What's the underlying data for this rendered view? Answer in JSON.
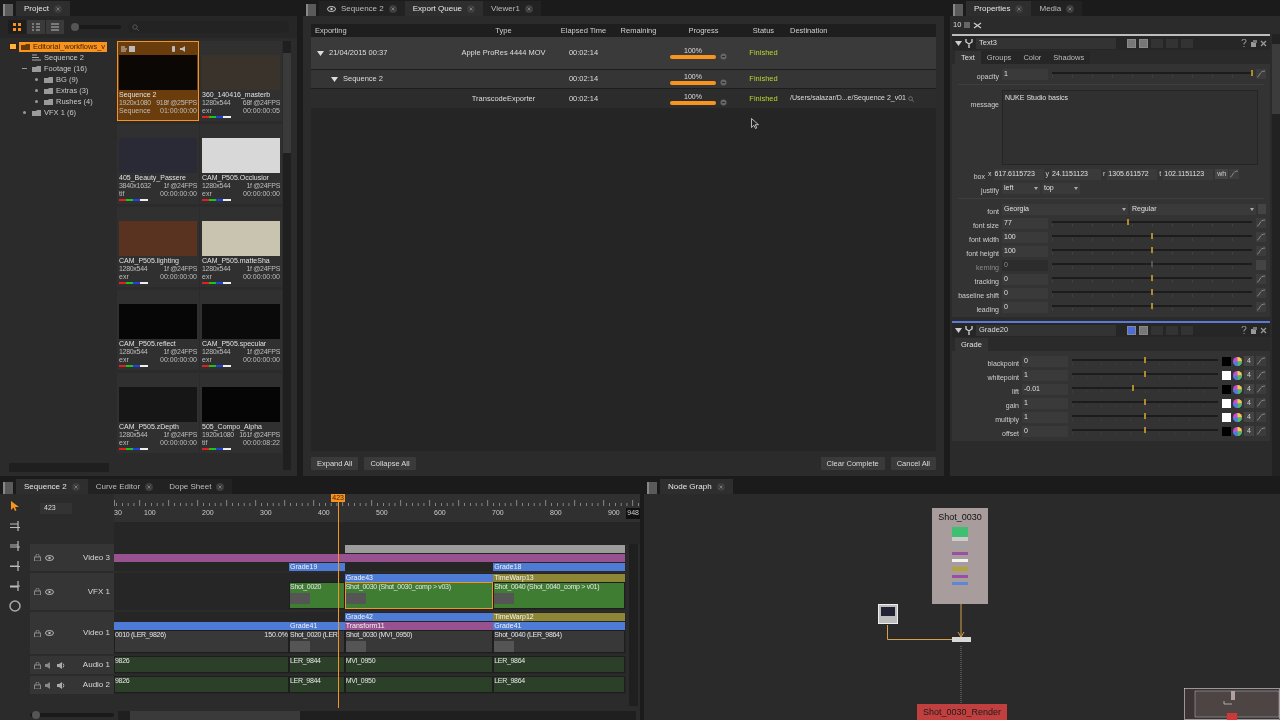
{
  "project": {
    "zoom": {
      "level": 0.08
    },
    "tabs": [
      {
        "label": "Project",
        "selected": true
      }
    ],
    "tree": [
      {
        "label": "Editorial_workflows_v",
        "kind": "project",
        "selected": true,
        "expanded": true,
        "children": [
          {
            "label": "Sequence 2",
            "kind": "sequence",
            "selected": false
          },
          {
            "label": "Footage (16)",
            "kind": "bin",
            "selected": false,
            "expanded": true,
            "children": [
              {
                "label": "BG (9)",
                "kind": "bin",
                "selected": false,
                "expanded": false
              },
              {
                "label": "Extras (3)",
                "kind": "bin",
                "selected": false,
                "expanded": false
              },
              {
                "label": "Rushes (4)",
                "kind": "bin",
                "selected": false,
                "expanded": false
              }
            ]
          },
          {
            "label": "VFX 1 (6)",
            "kind": "bin",
            "selected": false,
            "expanded": false
          }
        ]
      }
    ],
    "clips": [
      {
        "kind": "sequence",
        "name": "Sequence 2",
        "resolution": "1920x1080",
        "duration": "918f @25FPS",
        "type": "Sequence",
        "timecode": "01:00:00:00",
        "selected": true
      },
      {
        "kind": "clip",
        "name": "360_140416_masterb",
        "resolution": "1280x544",
        "duration": "68f @24FPS",
        "type": "exr",
        "timecode": "00:00:00:05",
        "selected": false
      },
      {
        "kind": "clip",
        "name": "405_Beauty_Passere",
        "resolution": "3840x1632",
        "duration": "1f @24FPS",
        "type": "tif",
        "timecode": "00:00:00:00",
        "selected": false
      },
      {
        "kind": "clip",
        "name": "CAM_P505.Occlusior",
        "resolution": "1280x544",
        "duration": "1f @24FPS",
        "type": "exr",
        "timecode": "00:00:00:00",
        "selected": false
      },
      {
        "kind": "clip",
        "name": "CAM_P505.lighting",
        "resolution": "1280x544",
        "duration": "1f @24FPS",
        "type": "exr",
        "timecode": "00:00:00:00",
        "selected": false
      },
      {
        "kind": "clip",
        "name": "CAM_P505.matteSha",
        "resolution": "1280x544",
        "duration": "1f @24FPS",
        "type": "exr",
        "timecode": "00:00:00:00",
        "selected": false
      },
      {
        "kind": "clip",
        "name": "CAM_P505.reflect",
        "resolution": "1280x544",
        "duration": "1f @24FPS",
        "type": "exr",
        "timecode": "00:00:00:00",
        "selected": false
      },
      {
        "kind": "clip",
        "name": "CAM_P505.specular",
        "resolution": "1280x544",
        "duration": "1f @24FPS",
        "type": "exr",
        "timecode": "00:00:00:00",
        "selected": false
      },
      {
        "kind": "clip",
        "name": "CAM_P505.zDepth",
        "resolution": "1280x544",
        "duration": "1f @24FPS",
        "type": "exr",
        "timecode": "00:00:00:00",
        "selected": false
      },
      {
        "kind": "clip",
        "name": "505_Compo_Alpha",
        "resolution": "1920x1080",
        "duration": "161f @24FPS",
        "type": "tif",
        "timecode": "00:00:08:22",
        "selected": false
      }
    ]
  },
  "export": {
    "tabs": [
      {
        "label": "Sequence 2",
        "selected": false
      },
      {
        "label": "Export Queue",
        "selected": true
      },
      {
        "label": "Viewer1",
        "selected": false
      }
    ],
    "columns": [
      "Exporting",
      "Type",
      "Elapsed Time",
      "Remaining",
      "Progress",
      "Status",
      "Destination"
    ],
    "rows": [
      {
        "kind": "job",
        "expanded": true,
        "exporting": "21/04/2015 00:37",
        "type": "Apple ProRes 4444 MOV",
        "elapsed": "00:02:14",
        "progress": "100%",
        "level": 1,
        "status": "Finished"
      },
      {
        "kind": "group",
        "expanded": true,
        "exporting": "Sequence 2",
        "elapsed": "00:02:14",
        "progress": "100%",
        "level": 1,
        "status": "Finished"
      },
      {
        "kind": "task",
        "type": "TranscodeExporter",
        "elapsed": "00:02:14",
        "progress": "100%",
        "level": 1,
        "status": "Finished",
        "destination": "/Users/salazar/D...e/Sequence 2_v01"
      }
    ],
    "buttons_left": [
      "Expand All",
      "Collapse All"
    ],
    "buttons_right": [
      "Clear Complete",
      "Cancel All"
    ]
  },
  "properties": {
    "tabs": [
      {
        "label": "Properties",
        "selected": true
      },
      {
        "label": "Media",
        "selected": false
      }
    ],
    "max_panels": "10",
    "nodes": [
      {
        "name": "Text3",
        "selected": false,
        "tabs": [
          {
            "label": "Text",
            "selected": true
          },
          {
            "label": "Groups",
            "selected": false
          },
          {
            "label": "Color",
            "selected": false
          },
          {
            "label": "Shadows",
            "selected": false
          }
        ],
        "knobs": [
          {
            "kind": "slider",
            "label": "opacity",
            "value": "1",
            "level": 1,
            "disabled": false
          },
          {
            "kind": "divider"
          },
          {
            "kind": "text",
            "label": "message",
            "value": "NUKE Studio basics"
          },
          {
            "kind": "box",
            "label": "box",
            "fields": [
              {
                "label": "x",
                "value": "617.6115723"
              },
              {
                "label": "y",
                "value": "24.1151123"
              },
              {
                "label": "r",
                "value": "1305.611572"
              },
              {
                "label": "t",
                "value": "102.1151123"
              }
            ],
            "button": "wh"
          },
          {
            "kind": "menus",
            "label": "justify",
            "options": [
              "left",
              "top"
            ]
          },
          {
            "kind": "divider"
          },
          {
            "kind": "font",
            "label": "font",
            "options": [
              "Georgia",
              "Regular"
            ]
          },
          {
            "kind": "slider",
            "label": "font size",
            "value": "77",
            "level": 0.38,
            "disabled": false
          },
          {
            "kind": "slider",
            "label": "font width",
            "value": "100",
            "level": 0.5,
            "disabled": false
          },
          {
            "kind": "slider",
            "label": "font height",
            "value": "100",
            "level": 0.5,
            "disabled": false
          },
          {
            "kind": "slider",
            "label": "kerning",
            "value": "0",
            "level": 0.5,
            "disabled": true
          },
          {
            "kind": "slider",
            "label": "tracking",
            "value": "0",
            "level": 0.5,
            "disabled": false
          },
          {
            "kind": "slider",
            "label": "baseline shift",
            "value": "0",
            "level": 0.5,
            "disabled": false
          },
          {
            "kind": "slider",
            "label": "leading",
            "value": "0",
            "level": 0.5,
            "disabled": false
          }
        ]
      },
      {
        "name": "Grade20",
        "selected": true,
        "tabs": [
          {
            "label": "Grade",
            "selected": true
          }
        ],
        "knobs": [
          {
            "kind": "color",
            "label": "blackpoint",
            "value": "0",
            "level": 0.5,
            "color": "#000000",
            "channels": "4"
          },
          {
            "kind": "color",
            "label": "whitepoint",
            "value": "1",
            "level": 0.5,
            "color": "#ffffff",
            "channels": "4"
          },
          {
            "kind": "color",
            "label": "lift",
            "value": "-0.01",
            "level": 0.42,
            "color": "#000000",
            "channels": "4"
          },
          {
            "kind": "color",
            "label": "gain",
            "value": "1",
            "level": 0.5,
            "color": "#ffffff",
            "channels": "4"
          },
          {
            "kind": "color",
            "label": "multiply",
            "value": "1",
            "level": 0.5,
            "color": "#ffffff",
            "channels": "4"
          },
          {
            "kind": "color",
            "label": "offset",
            "value": "0",
            "level": 0.5,
            "color": "#000000",
            "channels": "4"
          }
        ]
      }
    ]
  },
  "timeline": {
    "tabs": [
      {
        "label": "Sequence 2",
        "selected": true
      },
      {
        "label": "Curve Editor",
        "selected": false
      },
      {
        "label": "Dope Sheet",
        "selected": false
      }
    ],
    "zoom": {
      "level": 0.05
    },
    "frame": "423",
    "playhead": "423",
    "ruler": [
      "30",
      "100",
      "200",
      "300",
      "400",
      "500",
      "600",
      "700",
      "800",
      "900",
      "948"
    ],
    "tracks": [
      {
        "name": "Video 3",
        "kind": "video",
        "lanes": [
          {
            "kind": "effects",
            "items": [
              {
                "color": "#9c9c9c"
              }
            ]
          },
          {
            "kind": "effects",
            "items": [
              {
                "color": "#98528f"
              }
            ]
          },
          {
            "kind": "effects",
            "items": [
              {
                "label": "Grade19",
                "color": "#4d7bd6"
              },
              {
                "label": "Grade18",
                "color": "#4d7bd6"
              }
            ]
          }
        ]
      },
      {
        "name": "VFX 1",
        "kind": "vfx",
        "lanes": [
          {
            "kind": "effects",
            "items": [
              {
                "label": "Grade43",
                "color": "#4d7bd6"
              },
              {
                "label": "TimeWarp13",
                "color": "#8c8636"
              }
            ]
          },
          {
            "kind": "clips",
            "items": [
              {
                "label": "Shot_0020",
                "selected": false,
                "thumbnail": true
              },
              {
                "label": "Shot_0030 (Shot_0030_comp > v03)",
                "selected": true,
                "thumbnail": true
              },
              {
                "label": "Shot_0040 (Shot_0040_comp > v01)",
                "selected": false,
                "thumbnail": true
              }
            ]
          }
        ]
      },
      {
        "name": "Video 1",
        "kind": "video",
        "lanes": [
          {
            "kind": "effects",
            "items": [
              {
                "label": "Grade42",
                "color": "#4d7bd6"
              },
              {
                "label": "TimeWarp12",
                "color": "#8c8636"
              }
            ]
          },
          {
            "kind": "effects",
            "items": [
              {
                "color": "#4d7bd6"
              },
              {
                "label": "Grade41",
                "color": "#4d7bd6"
              },
              {
                "label": "Transform11",
                "color": "#98528f"
              },
              {
                "label": "Grade41",
                "color": "#4d7bd6"
              }
            ]
          },
          {
            "kind": "clips",
            "items": [
              {
                "label": "0010 (LER_9826)",
                "badge": "150.0%",
                "selected": false,
                "thumbnail": false
              },
              {
                "label": "Shot_0020 (LER",
                "selected": false,
                "thumbnail": true
              },
              {
                "label": "Shot_0030 (MVI_0950)",
                "selected": false,
                "thumbnail": true
              },
              {
                "label": "Shot_0040 (LER_9864)",
                "selected": false,
                "thumbnail": true
              }
            ]
          }
        ]
      },
      {
        "name": "Audio 1",
        "kind": "audio",
        "lanes": [
          {
            "kind": "clips",
            "items": [
              {
                "label": "9826",
                "selected": false,
                "thumbnail": false
              },
              {
                "label": "LER_9844",
                "selected": false,
                "thumbnail": false
              },
              {
                "label": "MVI_0950",
                "selected": false,
                "thumbnail": false
              },
              {
                "label": "LER_9864",
                "selected": false,
                "thumbnail": false
              }
            ]
          }
        ]
      },
      {
        "name": "Audio 2",
        "kind": "audio",
        "lanes": [
          {
            "kind": "clips",
            "items": [
              {
                "label": "9826",
                "selected": false,
                "thumbnail": false
              },
              {
                "label": "LER_9844",
                "selected": false,
                "thumbnail": false
              },
              {
                "label": "MVI_0950",
                "selected": false,
                "thumbnail": false
              },
              {
                "label": "LER_9864",
                "selected": false,
                "thumbnail": false
              }
            ]
          }
        ]
      }
    ]
  },
  "node_graph": {
    "tabs": [
      {
        "label": "Node Graph",
        "selected": true
      }
    ],
    "nodes": [
      {
        "kind": "group",
        "label": "Shot_0030"
      },
      {
        "kind": "read"
      },
      {
        "kind": "merge"
      },
      {
        "kind": "write",
        "label": "Shot_0030_Render"
      }
    ]
  }
}
